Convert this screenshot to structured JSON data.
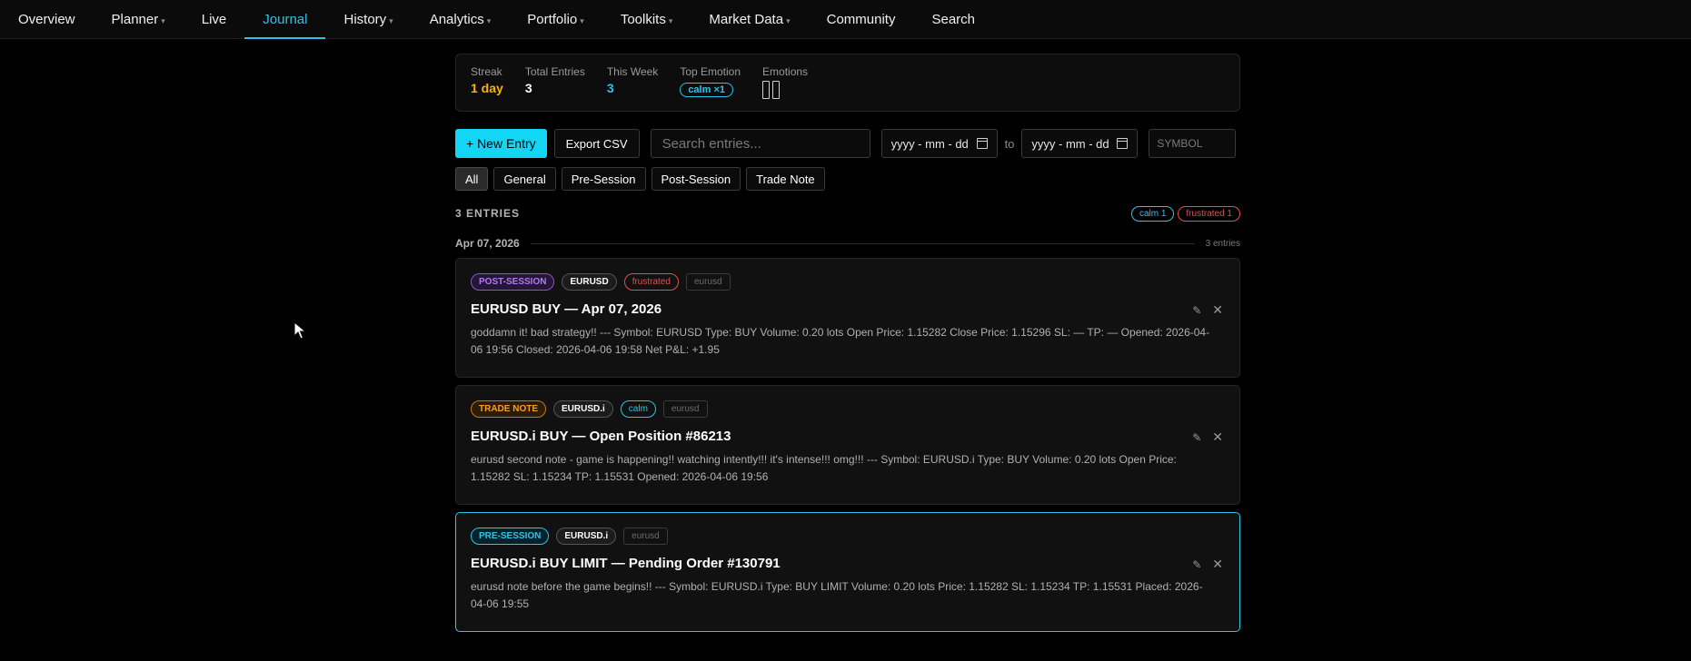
{
  "nav": [
    {
      "label": "Overview",
      "caret": false,
      "active": false
    },
    {
      "label": "Planner",
      "caret": true,
      "active": false
    },
    {
      "label": "Live",
      "caret": false,
      "active": false
    },
    {
      "label": "Journal",
      "caret": false,
      "active": true
    },
    {
      "label": "History",
      "caret": true,
      "active": false
    },
    {
      "label": "Analytics",
      "caret": true,
      "active": false
    },
    {
      "label": "Portfolio",
      "caret": true,
      "active": false
    },
    {
      "label": "Toolkits",
      "caret": true,
      "active": false
    },
    {
      "label": "Market Data",
      "caret": true,
      "active": false
    },
    {
      "label": "Community",
      "caret": false,
      "active": false
    },
    {
      "label": "Search",
      "caret": false,
      "active": false
    }
  ],
  "stats": {
    "streak_label": "Streak",
    "streak_value": "1 day",
    "total_label": "Total Entries",
    "total_value": "3",
    "week_label": "This Week",
    "week_value": "3",
    "top_emotion_label": "Top Emotion",
    "top_emotion_value": "calm ×1",
    "emotions_label": "Emotions"
  },
  "toolbar": {
    "new_entry": "+ New Entry",
    "export": "Export CSV",
    "search_placeholder": "Search entries...",
    "date_from": "yyyy - mm - dd",
    "to": "to",
    "date_to": "yyyy - mm - dd",
    "symbol_placeholder": "SYMBOL"
  },
  "filters": [
    "All",
    "General",
    "Pre-Session",
    "Post-Session",
    "Trade Note"
  ],
  "entries_header": {
    "count": "3 ENTRIES",
    "calm": "calm 1",
    "frustrated": "frustrated 1"
  },
  "date_group": {
    "label": "Apr 07, 2026",
    "count": "3 entries"
  },
  "cards": [
    {
      "type": "POST-SESSION",
      "symbol": "EURUSD",
      "emotion": "frustrated",
      "tag": "eurusd",
      "title": "EURUSD BUY — Apr 07, 2026",
      "body": "goddamn it! bad strategy!! --- Symbol: EURUSD Type: BUY Volume: 0.20 lots Open Price: 1.15282 Close Price: 1.15296 SL: — TP: — Opened: 2026-04-06 19:56 Closed: 2026-04-06 19:58 Net P&L: +1.95"
    },
    {
      "type": "TRADE NOTE",
      "symbol": "EURUSD.i",
      "emotion": "calm",
      "tag": "eurusd",
      "title": "EURUSD.i BUY — Open Position #86213",
      "body": "eurusd second note - game is happening!! watching intently!!! it's intense!!! omg!!! --- Symbol: EURUSD.i Type: BUY Volume: 0.20 lots Open Price: 1.15282 SL: 1.15234 TP: 1.15531 Opened: 2026-04-06 19:56"
    },
    {
      "type": "PRE-SESSION",
      "symbol": "EURUSD.i",
      "tag": "eurusd",
      "title": "EURUSD.i BUY LIMIT — Pending Order #130791",
      "body": "eurusd note before the game begins!! --- Symbol: EURUSD.i Type: BUY LIMIT Volume: 0.20 lots Price: 1.15282 SL: 1.15234 TP: 1.15531 Placed: 2026-04-06 19:55"
    }
  ],
  "colors": {
    "accent": "#29c6e8",
    "streak": "#f5b400",
    "post": "#b478f0",
    "trade": "#f5a020",
    "frustrated": "#e05050"
  }
}
